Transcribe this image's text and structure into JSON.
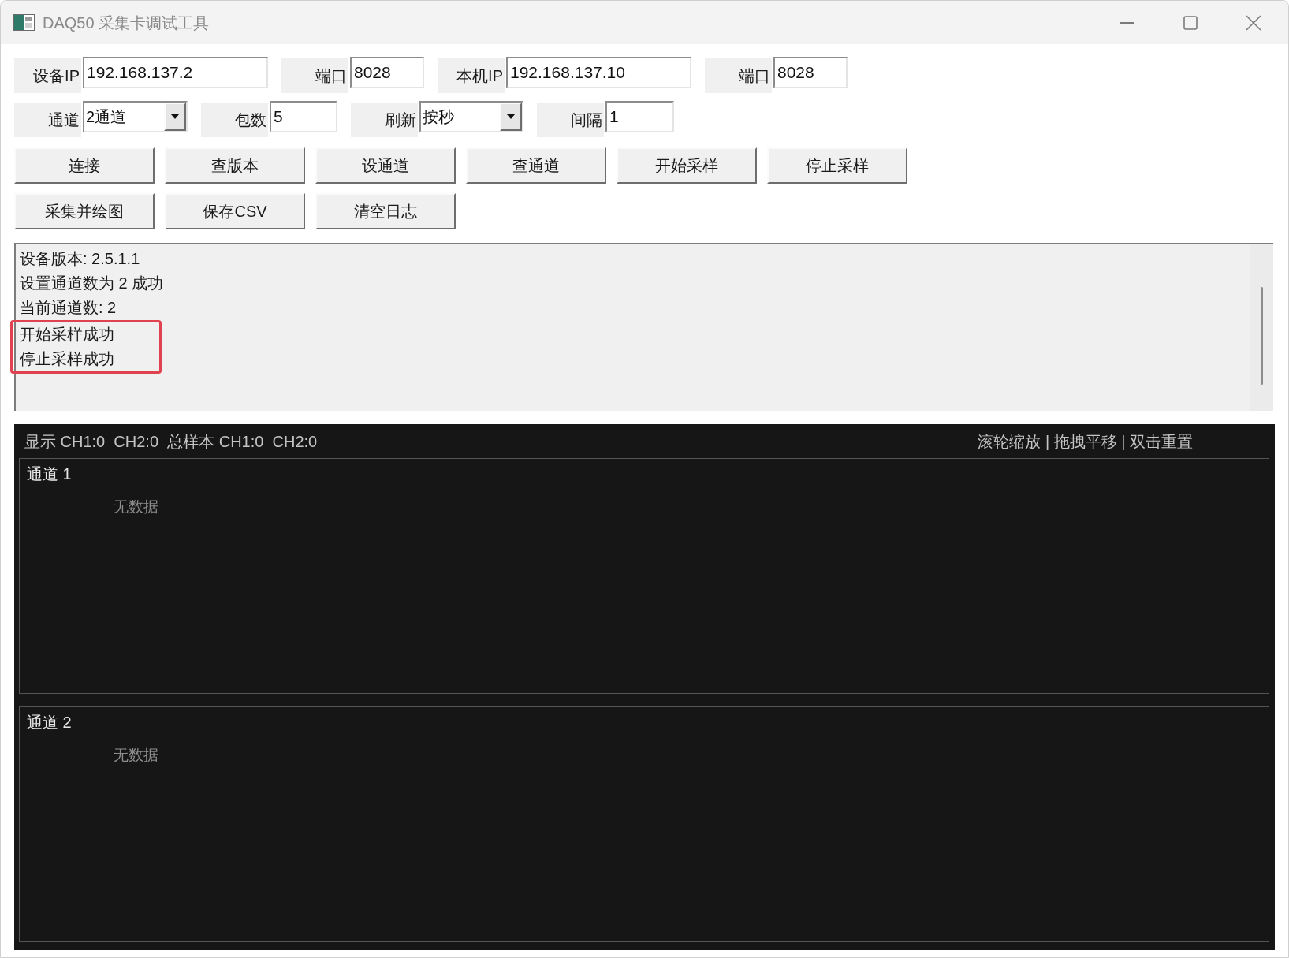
{
  "window": {
    "title": "DAQ50 采集卡调试工具"
  },
  "field_rows": [
    [
      {
        "label": "设备IP",
        "value": "192.168.137.2",
        "kind": "input"
      },
      {
        "label": "端口",
        "value": "8028",
        "kind": "input"
      },
      {
        "label": "本机IP",
        "value": "192.168.137.10",
        "kind": "input"
      },
      {
        "label": "端口",
        "value": "8028",
        "kind": "input"
      }
    ],
    [
      {
        "label": "通道",
        "value": "2通道",
        "kind": "dropdown"
      },
      {
        "label": "包数",
        "value": "5",
        "kind": "input"
      },
      {
        "label": "刷新",
        "value": "按秒",
        "kind": "dropdown"
      },
      {
        "label": "间隔",
        "value": "1",
        "kind": "input"
      }
    ]
  ],
  "button_rows": [
    [
      "连接",
      "查版本",
      "设通道",
      "查通道",
      "开始采样",
      "停止采样"
    ],
    [
      "采集并绘图",
      "保存CSV",
      "清空日志"
    ]
  ],
  "log": {
    "lines": [
      {
        "text": "设备版本: 2.5.1.1",
        "highlighted": false
      },
      {
        "text": "设置通道数为 2 成功",
        "highlighted": false
      },
      {
        "text": "当前通道数: 2",
        "highlighted": false
      },
      {
        "text": "开始采样成功",
        "highlighted": true
      },
      {
        "text": "停止采样成功",
        "highlighted": true
      }
    ]
  },
  "plot": {
    "status": "显示 CH1:0  CH2:0  总样本 CH1:0  CH2:0",
    "hint": "滚轮缩放 | 拖拽平移 | 双击重置",
    "channels": [
      {
        "title": "通道 1",
        "message": "无数据"
      },
      {
        "title": "通道 2",
        "message": "无数据"
      }
    ]
  }
}
